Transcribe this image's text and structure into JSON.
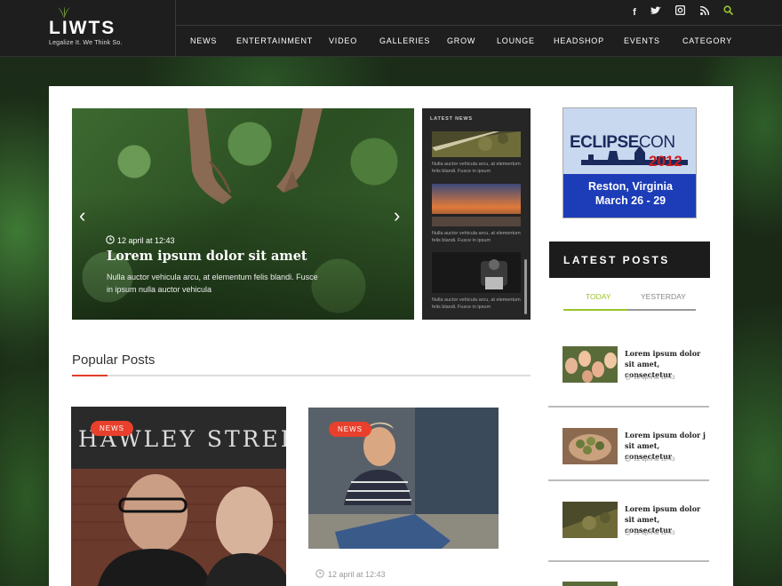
{
  "brand": {
    "name": "LIWTS",
    "tagline": "Legalize It. We Think So."
  },
  "social": [
    "facebook-icon",
    "twitter-icon",
    "instagram-icon",
    "rss-icon",
    "search-icon"
  ],
  "nav": {
    "items": [
      "NEWS",
      "ENTERTAINMENT",
      "VIDEO",
      "GALLERIES",
      "GROW",
      "LOUNGE",
      "HEADSHOP",
      "EVENTS",
      "CATEGORY"
    ]
  },
  "hero": {
    "date": "12 april at 12:43",
    "title": "Lorem ipsum dolor sit amet",
    "description": "Nulla auctor vehicula arcu, at elementum felis blandi. Fusce in ipsum nulla auctor vehicula"
  },
  "latest_news": {
    "title": "LATEST NEWS",
    "items": [
      {
        "text": "Nulla auctor vehicula arcu, at elementum felis blandi. Fusce in ipsum"
      },
      {
        "text": "Nulla auctor vehicula arcu, at elementum felis blandi. Fusce in ipsum"
      },
      {
        "text": "Nulla auctor vehicula arcu, at elementum felis blandi. Fusce in ipsum"
      }
    ]
  },
  "ad": {
    "logo_a": "ECLIPSE",
    "logo_b": "CON",
    "year": "2012",
    "city": "Reston, Virginia",
    "dates": "March 26 - 29"
  },
  "latest_posts": {
    "title": "LATEST POSTS",
    "tabs": [
      "TODAY",
      "YESTERDAY"
    ],
    "items": [
      {
        "title": "Lorem ipsum dolor sit amet, consectetur",
        "date": "12 april at 12:43"
      },
      {
        "title": "Lorem ipsum dolor j sit amet, consectetur",
        "date": "12 april at 12:43"
      },
      {
        "title": "Lorem ipsum dolor sit amet, consectetur",
        "date": "12 april at 12:43"
      }
    ]
  },
  "popular": {
    "title": "Popular Posts",
    "cards": [
      {
        "badge": "NEWS",
        "sign": "HAWLEY STREE"
      },
      {
        "badge": "NEWS",
        "date": "12 april at 12:43"
      }
    ]
  },
  "colors": {
    "accent_red": "#e8402c",
    "accent_green": "#9ac42b",
    "dark": "#1e1e1e"
  }
}
